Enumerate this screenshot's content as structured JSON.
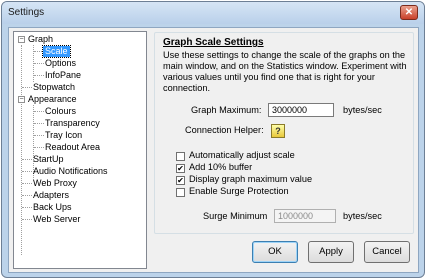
{
  "window": {
    "title": "Settings",
    "close_label": "✕"
  },
  "tree": {
    "graph": "Graph",
    "scale": "Scale",
    "options": "Options",
    "infopane": "InfoPane",
    "stopwatch": "Stopwatch",
    "appearance": "Appearance",
    "colours": "Colours",
    "transparency": "Transparency",
    "tray_icon": "Tray Icon",
    "readout_area": "Readout Area",
    "startup": "StartUp",
    "audio_notifications": "Audio Notifications",
    "web_proxy": "Web Proxy",
    "adapters": "Adapters",
    "back_ups": "Back Ups",
    "web_server": "Web Server",
    "expand_minus": "−"
  },
  "panel": {
    "heading": "Graph Scale Settings",
    "description": "Use these settings to change the scale of the graphs on the main window, and on the Statistics window. Experiment with various values until you find one that is right for your connection.",
    "graph_max_label": "Graph Maximum:",
    "graph_max_value": "3000000",
    "graph_max_unit": "bytes/sec",
    "helper_label": "Connection Helper:",
    "helper_glyph": "?",
    "checkboxes": {
      "auto_adjust": {
        "label": "Automatically adjust scale",
        "checked": false
      },
      "add_buffer": {
        "label": "Add 10% buffer",
        "checked": true
      },
      "display_max": {
        "label": "Display graph maximum value",
        "checked": true
      },
      "surge_protection": {
        "label": "Enable Surge Protection",
        "checked": false
      }
    },
    "check_glyph": "✔",
    "surge_min_label": "Surge Minimum",
    "surge_min_value": "1000000",
    "surge_min_unit": "bytes/sec"
  },
  "buttons": {
    "ok": "OK",
    "apply": "Apply",
    "cancel": "Cancel"
  }
}
